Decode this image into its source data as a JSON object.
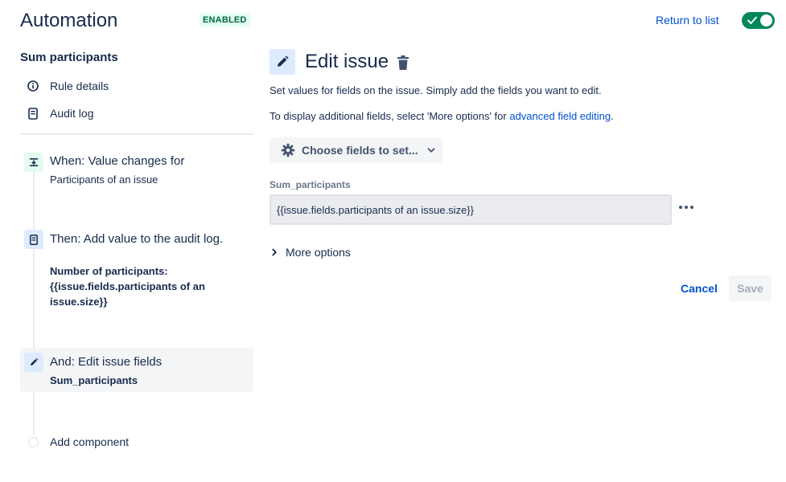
{
  "header": {
    "title": "Automation",
    "status_badge": "ENABLED",
    "return_link": "Return to list",
    "toggle_state": "on"
  },
  "sidebar": {
    "rule_name": "Sum participants",
    "links": [
      {
        "label": "Rule details",
        "icon": "info-icon"
      },
      {
        "label": "Audit log",
        "icon": "document-icon"
      }
    ],
    "steps": [
      {
        "title": "When: Value changes for",
        "subtitle": "Participants of an issue",
        "icon": "trigger-icon",
        "color": "#e3fcef"
      },
      {
        "title": "Then: Add value to the audit log.",
        "detail_line1": "Number of participants:",
        "detail_line2": "{{issue.fields.participants of an",
        "detail_line3": "issue.size}}",
        "icon": "document-icon",
        "color": "#deebff"
      },
      {
        "title": "And: Edit issue fields",
        "detail": "Sum_participants",
        "icon": "pencil-icon",
        "color": "#deebff",
        "selected": true
      }
    ],
    "add_component": "Add component"
  },
  "main": {
    "title": "Edit issue",
    "description": "Set values for fields on the issue. Simply add the fields you want to edit.",
    "additional_prefix": "To display additional fields, select 'More options' for ",
    "additional_link": "advanced field editing",
    "additional_suffix": ".",
    "choose_fields_label": "Choose fields to set...",
    "field": {
      "label": "Sum_participants",
      "value": "{{issue.fields.participants of an issue.size}}"
    },
    "more_options": "More options",
    "cancel_label": "Cancel",
    "save_label": "Save"
  }
}
